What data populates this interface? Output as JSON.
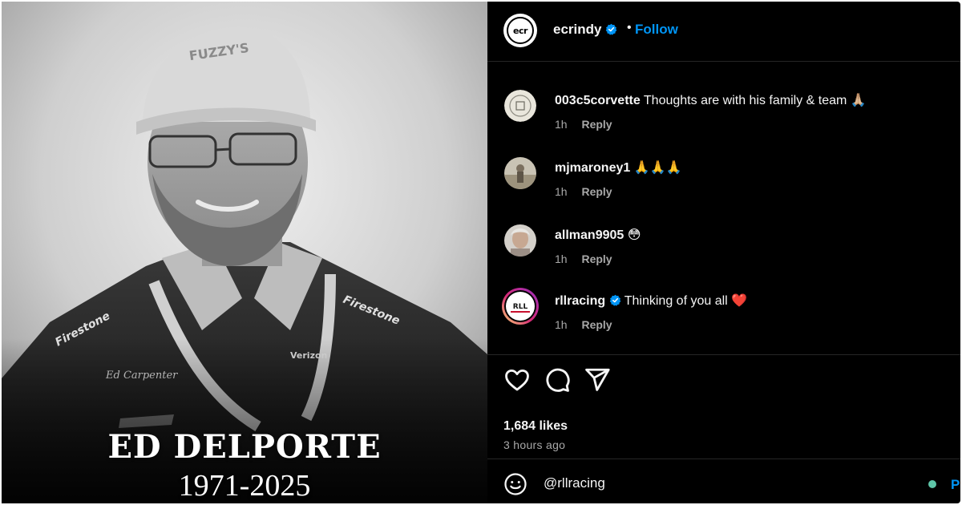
{
  "photo": {
    "name": "ED DELPORTE",
    "years": "1971-2025"
  },
  "post": {
    "username": "ecrindy",
    "separator": "•",
    "follow_label": "Follow",
    "avatar_text": "ecr",
    "verified": true
  },
  "comments": [
    {
      "user": "003c5corvette",
      "text": "Thoughts are with his family & team 🙏🏼",
      "time": "1h",
      "reply": "Reply",
      "verified": false
    },
    {
      "user": "mjmaroney1",
      "text": "🙏🙏🙏",
      "time": "1h",
      "reply": "Reply",
      "verified": false
    },
    {
      "user": "allman9905",
      "text": "😳",
      "time": "1h",
      "reply": "Reply",
      "verified": false
    },
    {
      "user": "rllracing",
      "text": "Thinking of you all ❤️",
      "time": "1h",
      "reply": "Reply",
      "verified": true
    }
  ],
  "actions": {
    "likes": "1,684 likes",
    "time_ago": "3 hours ago"
  },
  "composer": {
    "value": "@rllracing",
    "post_label": "Pos"
  },
  "colors": {
    "background": "#000000",
    "accent": "#0095f6",
    "muted": "#a8a8a8",
    "text": "#f5f5f5"
  }
}
